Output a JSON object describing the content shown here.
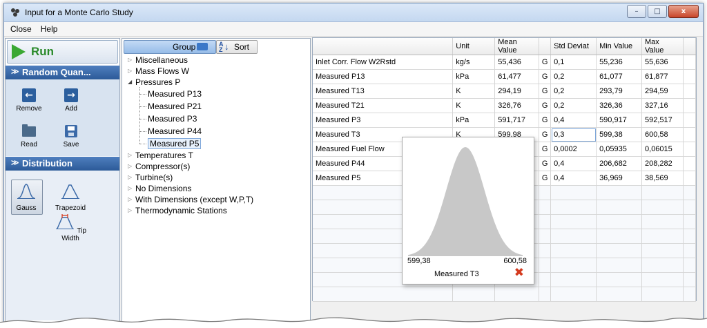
{
  "window": {
    "title": "Input for a Monte Carlo Study",
    "minimize": "–",
    "maximize": "□",
    "close": "x"
  },
  "menu": {
    "items": [
      "Close",
      "Help"
    ]
  },
  "left": {
    "run_label": "Run",
    "random_section": "Random Quan...",
    "tools": {
      "remove": "Remove",
      "add": "Add",
      "read": "Read",
      "save": "Save"
    },
    "distribution_section": "Distribution",
    "dist": {
      "gauss": "Gauss",
      "trapezoid": "Trapezoid",
      "tip_width": "Tip Width"
    },
    "selected_distribution": "Gauss"
  },
  "tree": {
    "group_label": "Group",
    "sort_label": "Sort",
    "nodes": [
      {
        "label": "Miscellaneous",
        "expanded": false
      },
      {
        "label": "Mass Flows W",
        "expanded": false
      },
      {
        "label": "Pressures P",
        "expanded": true
      },
      {
        "label": "Temperatures T",
        "expanded": false
      },
      {
        "label": "Compressor(s)",
        "expanded": false
      },
      {
        "label": "Turbine(s)",
        "expanded": false
      },
      {
        "label": "No Dimensions",
        "expanded": false
      },
      {
        "label": "With Dimensions (except W,P,T)",
        "expanded": false
      },
      {
        "label": "Thermodynamic Stations",
        "expanded": false
      }
    ],
    "pressure_children": [
      "Measured P13",
      "Measured P21",
      "Measured P3",
      "Measured P44",
      "Measured P5"
    ],
    "selected_child": "Measured P5"
  },
  "grid": {
    "headers": [
      "",
      "Unit",
      "Mean Value",
      "",
      "Std Deviat",
      "Min Value",
      "Max Value"
    ],
    "rows": [
      [
        "Inlet Corr. Flow W2Rstd",
        "kg/s",
        "55,436",
        "G",
        "0,1",
        "55,236",
        "55,636"
      ],
      [
        "Measured P13",
        "kPa",
        "61,477",
        "G",
        "0,2",
        "61,077",
        "61,877"
      ],
      [
        "Measured T13",
        "K",
        "294,19",
        "G",
        "0,2",
        "293,79",
        "294,59"
      ],
      [
        "Measured T21",
        "K",
        "326,76",
        "G",
        "0,2",
        "326,36",
        "327,16"
      ],
      [
        "Measured P3",
        "kPa",
        "591,717",
        "G",
        "0,4",
        "590,917",
        "592,517"
      ],
      [
        "Measured T3",
        "K",
        "599,98",
        "G",
        "0,3",
        "599,38",
        "600,58"
      ],
      [
        "Measured Fuel Flow",
        "",
        "",
        "G",
        "0,0002",
        "0,05935",
        "0,06015"
      ],
      [
        "Measured P44",
        "",
        "",
        "G",
        "0,4",
        "206,682",
        "208,282"
      ],
      [
        "Measured P5",
        "",
        "",
        "G",
        "0,4",
        "36,969",
        "38,569"
      ]
    ]
  },
  "popup": {
    "min": "599,38",
    "max": "600,58",
    "name": "Measured T3",
    "close_icon": "✖",
    "fill_color": "#c8c8c8"
  }
}
